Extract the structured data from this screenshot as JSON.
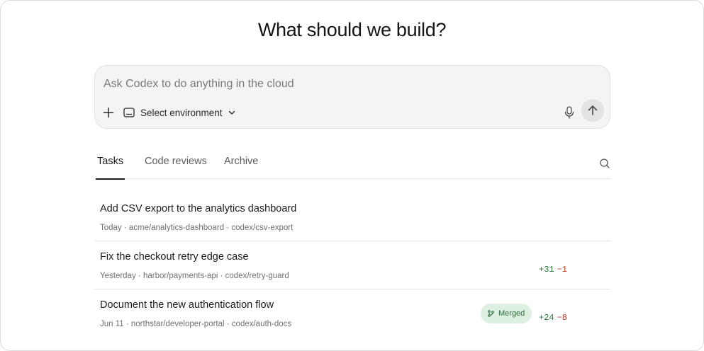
{
  "heading": "What should we build?",
  "composer": {
    "placeholder": "Ask Codex to do anything in the cloud",
    "environment_label": "Select environment"
  },
  "tabs": [
    {
      "label": "Tasks",
      "active": true
    },
    {
      "label": "Code reviews",
      "active": false
    },
    {
      "label": "Archive",
      "active": false
    }
  ],
  "tasks": [
    {
      "title": "Add CSV export to the analytics dashboard",
      "meta": "Today · acme/analytics-dashboard · codex/csv-export",
      "badge": "",
      "additions": "",
      "deletions": ""
    },
    {
      "title": "Fix the checkout retry edge case",
      "meta": "Yesterday · harbor/payments-api · codex/retry-guard",
      "badge": "",
      "additions": "+31",
      "deletions": "−1"
    },
    {
      "title": "Document the new authentication flow",
      "meta": "Jun 11 · northstar/developer-portal · codex/auth-docs",
      "badge": "Merged",
      "additions": "+24",
      "deletions": "−8"
    }
  ],
  "colors": {
    "additions": "#1f7a34",
    "deletions": "#c0392b",
    "merged_badge_bg": "#ddf0e1",
    "merged_badge_text": "#2c6b3b"
  }
}
